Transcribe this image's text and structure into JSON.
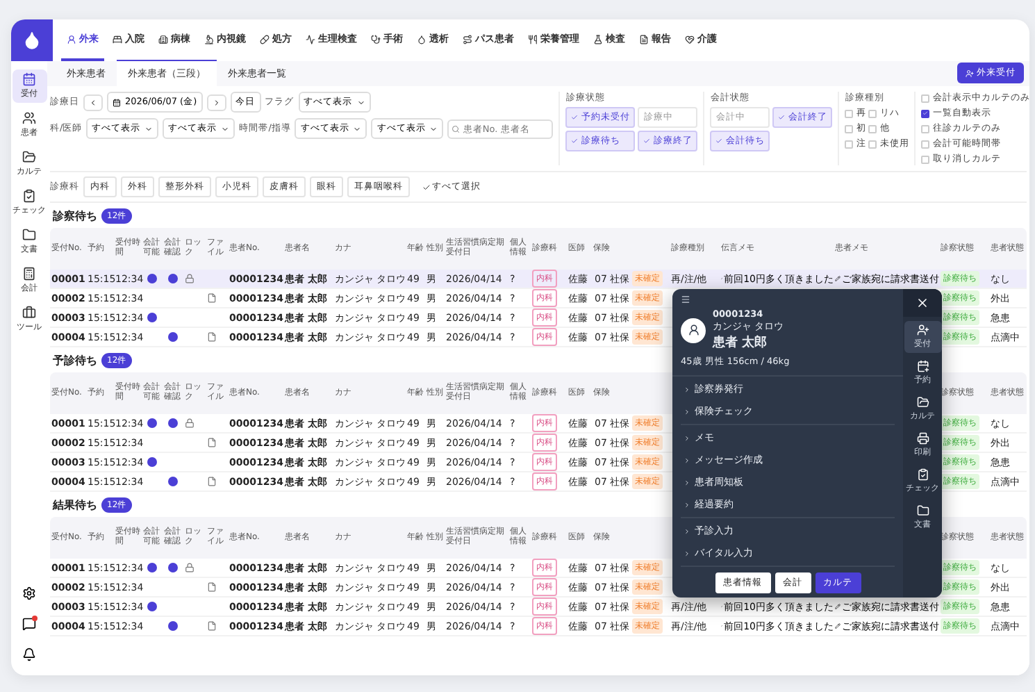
{
  "nav": [
    {
      "label": "外来",
      "selected": true
    },
    {
      "label": "入院",
      "selected": false
    },
    {
      "label": "病棟",
      "selected": false
    },
    {
      "label": "内視鏡",
      "selected": false
    },
    {
      "label": "処方",
      "selected": false
    },
    {
      "label": "生理検査",
      "selected": false
    },
    {
      "label": "手術",
      "selected": false
    },
    {
      "label": "透析",
      "selected": false
    },
    {
      "label": "パス患者",
      "selected": false
    },
    {
      "label": "栄養管理",
      "selected": false
    },
    {
      "label": "検査",
      "selected": false
    },
    {
      "label": "報告",
      "selected": false
    },
    {
      "label": "介護",
      "selected": false
    }
  ],
  "sidebar": [
    {
      "label": "受付",
      "selected": true
    },
    {
      "label": "患者",
      "selected": false
    },
    {
      "label": "カルテ",
      "selected": false
    },
    {
      "label": "チェック",
      "selected": false
    },
    {
      "label": "文書",
      "selected": false
    },
    {
      "label": "会計",
      "selected": false
    },
    {
      "label": "ツール",
      "selected": false
    }
  ],
  "tabs": [
    {
      "label": "外来患者",
      "selected": false
    },
    {
      "label": "外来患者（三段）",
      "selected": true
    },
    {
      "label": "外来患者一覧",
      "selected": false
    }
  ],
  "reception_button": "外来受付",
  "filters": {
    "date_label": "診療日",
    "date": "2026/06/07 (金)",
    "today": "今日",
    "flag_label": "フラグ",
    "flag": "すべて表示",
    "dept_label": "科/医師",
    "dept_values": [
      "すべて表示",
      "すべて表示"
    ],
    "time_label": "時間帯/指導",
    "time_values": [
      "すべて表示",
      "すべて表示"
    ],
    "search_placeholder": "患者No. 患者名"
  },
  "status_groups": [
    {
      "title": "診療状態",
      "chips": [
        {
          "label": "予約未受付",
          "checked": true
        },
        {
          "label": "診療中",
          "checked": false
        },
        {
          "label": "診療待ち",
          "checked": true
        },
        {
          "label": "診療終了",
          "checked": true
        }
      ]
    },
    {
      "title": "会計状態",
      "chips": [
        {
          "label": "会計中",
          "checked": false
        },
        {
          "label": "会計終了",
          "checked": true
        },
        {
          "label": "会計待ち",
          "checked": true
        }
      ]
    }
  ],
  "visit_types": {
    "title": "診療種別",
    "options": [
      {
        "label": "再",
        "checked": false
      },
      {
        "label": "リハ",
        "checked": false
      },
      {
        "label": "初",
        "checked": false
      },
      {
        "label": "他",
        "checked": false
      },
      {
        "label": "注",
        "checked": false
      },
      {
        "label": "未使用",
        "checked": false
      }
    ]
  },
  "options": [
    {
      "label": "会計表示中カルテのみ",
      "checked": false
    },
    {
      "label": "一覧自動表示",
      "checked": true
    },
    {
      "label": "往診カルテのみ",
      "checked": false
    },
    {
      "label": "会計可能時間帯",
      "checked": false
    },
    {
      "label": "取り消しカルテ",
      "checked": false
    }
  ],
  "departments": {
    "label": "診療科",
    "items": [
      {
        "label": "内科",
        "selected": false
      },
      {
        "label": "外科",
        "selected": false
      },
      {
        "label": "整形外科",
        "selected": false
      },
      {
        "label": "小児科",
        "selected": false
      },
      {
        "label": "皮膚科",
        "selected": false
      },
      {
        "label": "眼科",
        "selected": false
      },
      {
        "label": "耳鼻咽喉科",
        "selected": false
      }
    ],
    "select_all": {
      "label": "すべて選択",
      "checked": true
    }
  },
  "sections": [
    {
      "title": "診察待ち",
      "count": "12件",
      "columns": [
        "受付No.",
        "予約",
        "受付時間",
        "会計可能",
        "会計確認",
        "ロック",
        "ファイル",
        "患者No.",
        "患者名",
        "カナ",
        "年齢",
        "性別",
        "生活習慣病定期受付日",
        "個人情報",
        "診療科",
        "医師",
        "保険",
        "診療種別",
        "伝言メモ",
        "患者メモ",
        "診察状態",
        "患者状態"
      ],
      "rows": [
        {
          "no": "00001",
          "reserved": "15:15",
          "time": "12:34",
          "payable": true,
          "confirmed": true,
          "locked": true,
          "file": false,
          "patient_no": "00001234",
          "name": "患者 太郎",
          "kana": "カンジャ タロウ",
          "age": "49",
          "sex": "男",
          "date": "2026/04/14",
          "info": "?",
          "dept": "内科",
          "doctor": "佐藤",
          "insurance": "07 社保",
          "insurance_state": "未確定",
          "type": "再/注/他",
          "visit_memo": "前回10円多く頂きました",
          "patient_memo": "ご家族宛に請求書送付",
          "status": "診察待ち",
          "condition": "なし",
          "selected": true
        },
        {
          "no": "00002",
          "reserved": "15:15",
          "time": "12:34",
          "payable": false,
          "confirmed": false,
          "locked": false,
          "file": true,
          "patient_no": "00001234",
          "name": "患者 太郎",
          "kana": "カンジャ タロウ",
          "age": "49",
          "sex": "男",
          "date": "2026/04/14",
          "info": "?",
          "dept": "内科",
          "doctor": "佐藤",
          "insurance": "07 社保",
          "insurance_state": "未確定",
          "status": "診察待ち",
          "condition": "外出",
          "selected": false
        },
        {
          "no": "00003",
          "reserved": "15:15",
          "time": "12:34",
          "payable": true,
          "confirmed": false,
          "locked": false,
          "file": false,
          "patient_no": "00001234",
          "name": "患者 太郎",
          "kana": "カンジャ タロウ",
          "age": "49",
          "sex": "男",
          "date": "2026/04/14",
          "info": "?",
          "dept": "内科",
          "doctor": "佐藤",
          "insurance": "07 社保",
          "insurance_state": "未確定",
          "status": "診察待ち",
          "condition": "急患",
          "selected": false
        },
        {
          "no": "00004",
          "reserved": "15:15",
          "time": "12:34",
          "payable": false,
          "confirmed": true,
          "locked": false,
          "file": true,
          "patient_no": "00001234",
          "name": "患者 太郎",
          "kana": "カンジャ タロウ",
          "age": "49",
          "sex": "男",
          "date": "2026/04/14",
          "info": "?",
          "dept": "内科",
          "doctor": "佐藤",
          "insurance": "07 社保",
          "insurance_state": "未確定",
          "status": "診察待ち",
          "condition": "点滴中",
          "selected": false
        }
      ]
    },
    {
      "title": "予診待ち",
      "count": "12件",
      "columns": [
        "受付No.",
        "予約",
        "受付時間",
        "会計可能",
        "会計確認",
        "ロック",
        "ファイル",
        "患者No.",
        "患者名",
        "カナ",
        "年齢",
        "性別",
        "生活習慣病定期受付日",
        "個人情報",
        "診療科",
        "医師",
        "保険",
        null,
        null,
        null,
        "診察状態",
        "患者状態"
      ],
      "rows": [
        {
          "no": "00001",
          "reserved": "15:15",
          "time": "12:34",
          "payable": true,
          "confirmed": true,
          "locked": true,
          "file": false,
          "patient_no": "00001234",
          "name": "患者 太郎",
          "kana": "カンジャ タロウ",
          "age": "49",
          "sex": "男",
          "date": "2026/04/14",
          "info": "?",
          "dept": "内科",
          "doctor": "佐藤",
          "insurance": "07 社保",
          "insurance_state": "未確定",
          "status": "診察待ち",
          "condition": "なし",
          "selected": false
        },
        {
          "no": "00002",
          "reserved": "15:15",
          "time": "12:34",
          "payable": false,
          "confirmed": false,
          "locked": false,
          "file": true,
          "patient_no": "00001234",
          "name": "患者 太郎",
          "kana": "カンジャ タロウ",
          "age": "49",
          "sex": "男",
          "date": "2026/04/14",
          "info": "?",
          "dept": "内科",
          "doctor": "佐藤",
          "insurance": "07 社保",
          "insurance_state": "未確定",
          "status": "診察待ち",
          "condition": "外出",
          "selected": false
        },
        {
          "no": "00003",
          "reserved": "15:15",
          "time": "12:34",
          "payable": true,
          "confirmed": false,
          "locked": false,
          "file": false,
          "patient_no": "00001234",
          "name": "患者 太郎",
          "kana": "カンジャ タロウ",
          "age": "49",
          "sex": "男",
          "date": "2026/04/14",
          "info": "?",
          "dept": "内科",
          "doctor": "佐藤",
          "insurance": "07 社保",
          "insurance_state": "未確定",
          "status": "診察待ち",
          "condition": "急患",
          "selected": false
        },
        {
          "no": "00004",
          "reserved": "15:15",
          "time": "12:34",
          "payable": false,
          "confirmed": true,
          "locked": false,
          "file": true,
          "patient_no": "00001234",
          "name": "患者 太郎",
          "kana": "カンジャ タロウ",
          "age": "49",
          "sex": "男",
          "date": "2026/04/14",
          "info": "?",
          "dept": "内科",
          "doctor": "佐藤",
          "insurance": "07 社保",
          "insurance_state": "未確定",
          "status": "診察待ち",
          "condition": "点滴中",
          "selected": false
        }
      ]
    },
    {
      "title": "結果待ち",
      "count": "12件",
      "columns": [
        "受付No.",
        "予約",
        "受付時間",
        "会計可能",
        "会計確認",
        "ロック",
        "ファイル",
        "患者No.",
        "患者名",
        "カナ",
        "年齢",
        "性別",
        "生活習慣病定期受付日",
        "個人情報",
        "診療科",
        "医師",
        "保険",
        null,
        null,
        null,
        "診察状態",
        "患者状態"
      ],
      "rows": [
        {
          "no": "00001",
          "reserved": "15:15",
          "time": "12:34",
          "payable": true,
          "confirmed": true,
          "locked": true,
          "file": false,
          "patient_no": "00001234",
          "name": "患者 太郎",
          "kana": "カンジャ タロウ",
          "age": "49",
          "sex": "男",
          "date": "2026/04/14",
          "info": "?",
          "dept": "内科",
          "doctor": "佐藤",
          "insurance": "07 社保",
          "insurance_state": "未確定",
          "status": "診察待ち",
          "condition": "なし",
          "selected": false
        },
        {
          "no": "00002",
          "reserved": "15:15",
          "time": "12:34",
          "payable": false,
          "confirmed": false,
          "locked": false,
          "file": true,
          "patient_no": "00001234",
          "name": "患者 太郎",
          "kana": "カンジャ タロウ",
          "age": "49",
          "sex": "男",
          "date": "2026/04/14",
          "info": "?",
          "dept": "内科",
          "doctor": "佐藤",
          "insurance": "07 社保",
          "insurance_state": "未確定",
          "status": "診察待ち",
          "condition": "外出",
          "selected": false
        },
        {
          "no": "00003",
          "reserved": "15:15",
          "time": "12:34",
          "payable": true,
          "confirmed": false,
          "locked": false,
          "file": false,
          "patient_no": "00001234",
          "name": "患者 太郎",
          "kana": "カンジャ タロウ",
          "age": "49",
          "sex": "男",
          "date": "2026/04/14",
          "info": "?",
          "dept": "内科",
          "doctor": "佐藤",
          "insurance": "07 社保",
          "insurance_state": "未確定",
          "type": "再/注/他",
          "visit_memo": "前回10円多く頂きました",
          "patient_memo": "ご家族宛に請求書送付",
          "status": "診察待ち",
          "condition": "急患",
          "selected": false
        },
        {
          "no": "00004",
          "reserved": "15:15",
          "time": "12:34",
          "payable": false,
          "confirmed": true,
          "locked": false,
          "file": true,
          "patient_no": "00001234",
          "name": "患者 太郎",
          "kana": "カンジャ タロウ",
          "age": "49",
          "sex": "男",
          "date": "2026/04/14",
          "info": "?",
          "dept": "内科",
          "doctor": "佐藤",
          "insurance": "07 社保",
          "insurance_state": "未確定",
          "type": "再/注/他",
          "visit_memo": "前回10円多く頂きました",
          "patient_memo": "ご家族宛に請求書送付",
          "status": "診察待ち",
          "condition": "点滴中",
          "selected": false
        }
      ]
    }
  ],
  "panel": {
    "patient_no": "00001234",
    "kana": "カンジャ タロウ",
    "name": "患者 太郎",
    "profile": "45歳 男性 156cm / 46kg",
    "menu_groups": [
      [
        "診察券発行",
        "保険チェック"
      ],
      [
        "メモ",
        "メッセージ作成",
        "患者周知板",
        "経過要約"
      ],
      [
        "予診入力",
        "バイタル入力"
      ]
    ],
    "rail": [
      {
        "label": "受付",
        "selected": true
      },
      {
        "label": "予約",
        "selected": false
      },
      {
        "label": "カルテ",
        "selected": false
      },
      {
        "label": "印刷",
        "selected": false
      },
      {
        "label": "チェック",
        "selected": false
      },
      {
        "label": "文書",
        "selected": false
      }
    ],
    "buttons": [
      {
        "label": "患者情報",
        "kind": "secondary"
      },
      {
        "label": "会計",
        "kind": "secondary"
      },
      {
        "label": "カルテ",
        "kind": "primary"
      }
    ]
  }
}
